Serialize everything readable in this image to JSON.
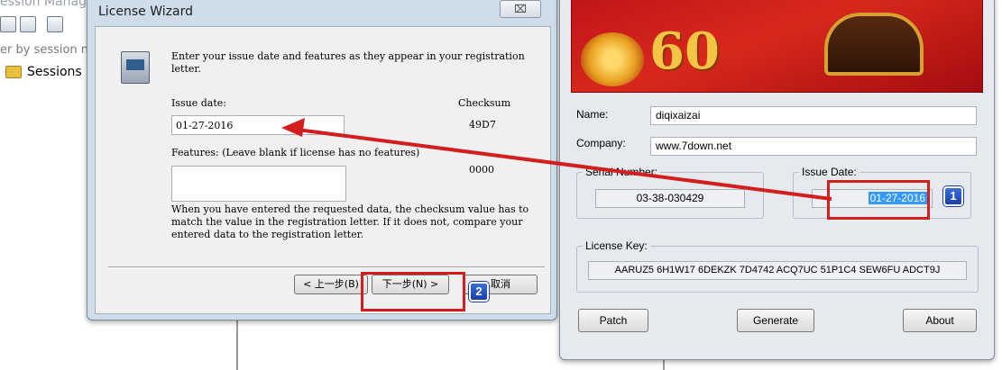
{
  "background": {
    "window_title": "ession Manage",
    "filter_placeholder": "er by session n",
    "tree_item": "Sessions"
  },
  "wizard": {
    "title": "License Wizard",
    "close_label": "⌧",
    "intro": "Enter your issue date and features as they appear in your registration letter.",
    "issue_date_label": "Issue date:",
    "checksum_label": "Checksum",
    "issue_date_value": "01-27-2016",
    "issue_checksum": "49D7",
    "features_label": "Features: (Leave blank if license has no features)",
    "features_value": "",
    "features_checksum": "0000",
    "help_text": "When you have entered the requested data, the checksum value has to match the value in the registration letter. If it does not, compare your entered data to the registration letter.",
    "back_button": "< 上一步(B)",
    "next_button": "下一步(N) >",
    "cancel_button": "取消"
  },
  "keygen": {
    "banner_text": "60",
    "name_label": "Name:",
    "name_value": "diqixaizai",
    "company_label": "Company:",
    "company_value": "www.7down.net",
    "serial_label": "Serial Number:",
    "serial_value": "03-38-030429",
    "issue_label": "Issue Date:",
    "issue_value": "01-27-2016",
    "license_label": "License Key:",
    "license_value": "AARUZ5 6H1W17 6DEKZK 7D4742 ACQ7UC 51P1C4 SEW6FU ADCT9J",
    "patch_button": "Patch",
    "generate_button": "Generate",
    "about_button": "About"
  },
  "annotations": {
    "badge_1": "1",
    "badge_2": "2",
    "highlight_color": "#d41e1e",
    "badge_color": "#2a55c0"
  }
}
